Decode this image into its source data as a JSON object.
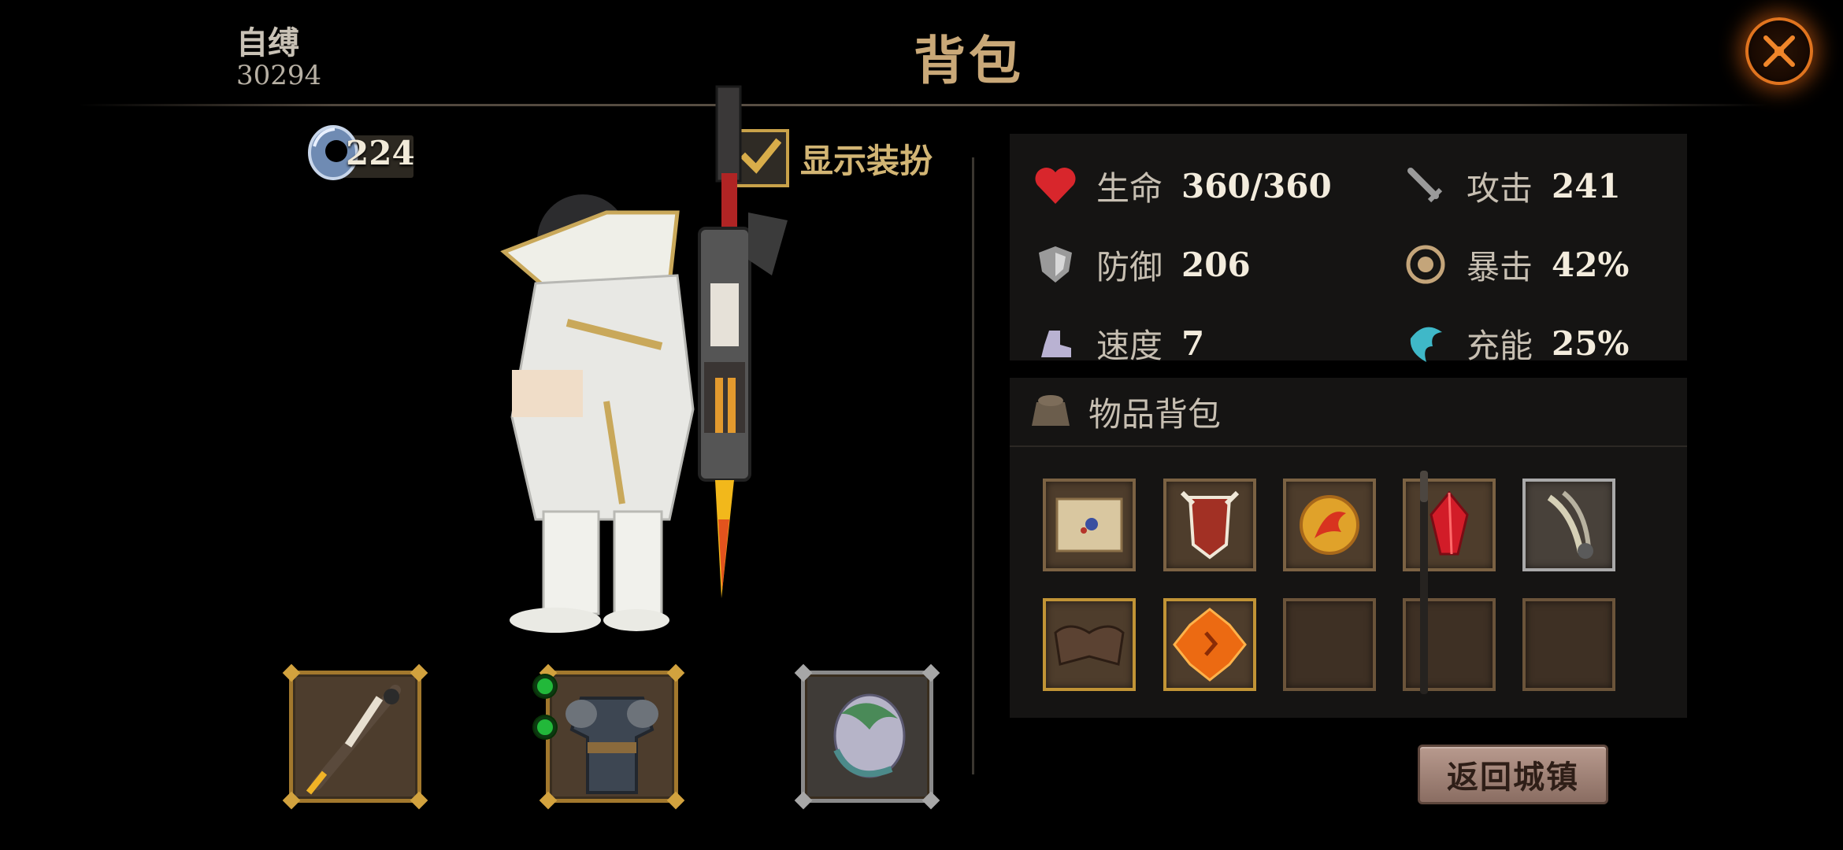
{
  "header": {
    "player_name": "自缚",
    "player_id": "30294",
    "title": "背包",
    "close_icon": "crossed-swords-close-icon"
  },
  "currency": {
    "icon": "ring-currency-icon",
    "value": "224"
  },
  "show_outfit": {
    "label": "显示装扮",
    "checked": true
  },
  "equipment": [
    {
      "name": "weapon-slot",
      "icon": "gun-lance-icon"
    },
    {
      "name": "armor-slot",
      "icon": "armor-set-icon",
      "gem_sockets": 2
    },
    {
      "name": "pet-slot",
      "icon": "dragon-egg-icon"
    }
  ],
  "stats": {
    "hp": {
      "label": "生命",
      "value": "360/360",
      "icon": "heart-icon"
    },
    "attack": {
      "label": "攻击",
      "value": "241",
      "icon": "sword-icon"
    },
    "defense": {
      "label": "防御",
      "value": "206",
      "icon": "shield-icon"
    },
    "crit": {
      "label": "暴击",
      "value": "42%",
      "icon": "crit-target-icon"
    },
    "speed": {
      "label": "速度",
      "value": "7",
      "icon": "boot-icon"
    },
    "charge": {
      "label": "充能",
      "value": "25%",
      "icon": "charge-claw-icon"
    }
  },
  "inventory": {
    "title": "物品背包",
    "icon": "bag-icon",
    "items": [
      {
        "icon": "map-scroll-icon",
        "frame": "normal"
      },
      {
        "icon": "tribal-mask-icon",
        "frame": "normal"
      },
      {
        "icon": "fire-coin-icon",
        "frame": "normal"
      },
      {
        "icon": "red-crystal-icon",
        "frame": "normal"
      },
      {
        "icon": "claw-blade-icon",
        "frame": "silver"
      },
      {
        "icon": "shoulder-armor-icon",
        "frame": "gold"
      },
      {
        "icon": "orange-rune-icon",
        "frame": "gold"
      },
      {
        "icon": "",
        "frame": "empty"
      },
      {
        "icon": "",
        "frame": "empty"
      },
      {
        "icon": "",
        "frame": "empty"
      }
    ]
  },
  "return_button": {
    "label": "返回城镇"
  },
  "colors": {
    "title_gold": "#c9a878",
    "frame_gold": "#c19436",
    "close_glow": "#e0741f",
    "socket_green": "#22b83a"
  }
}
